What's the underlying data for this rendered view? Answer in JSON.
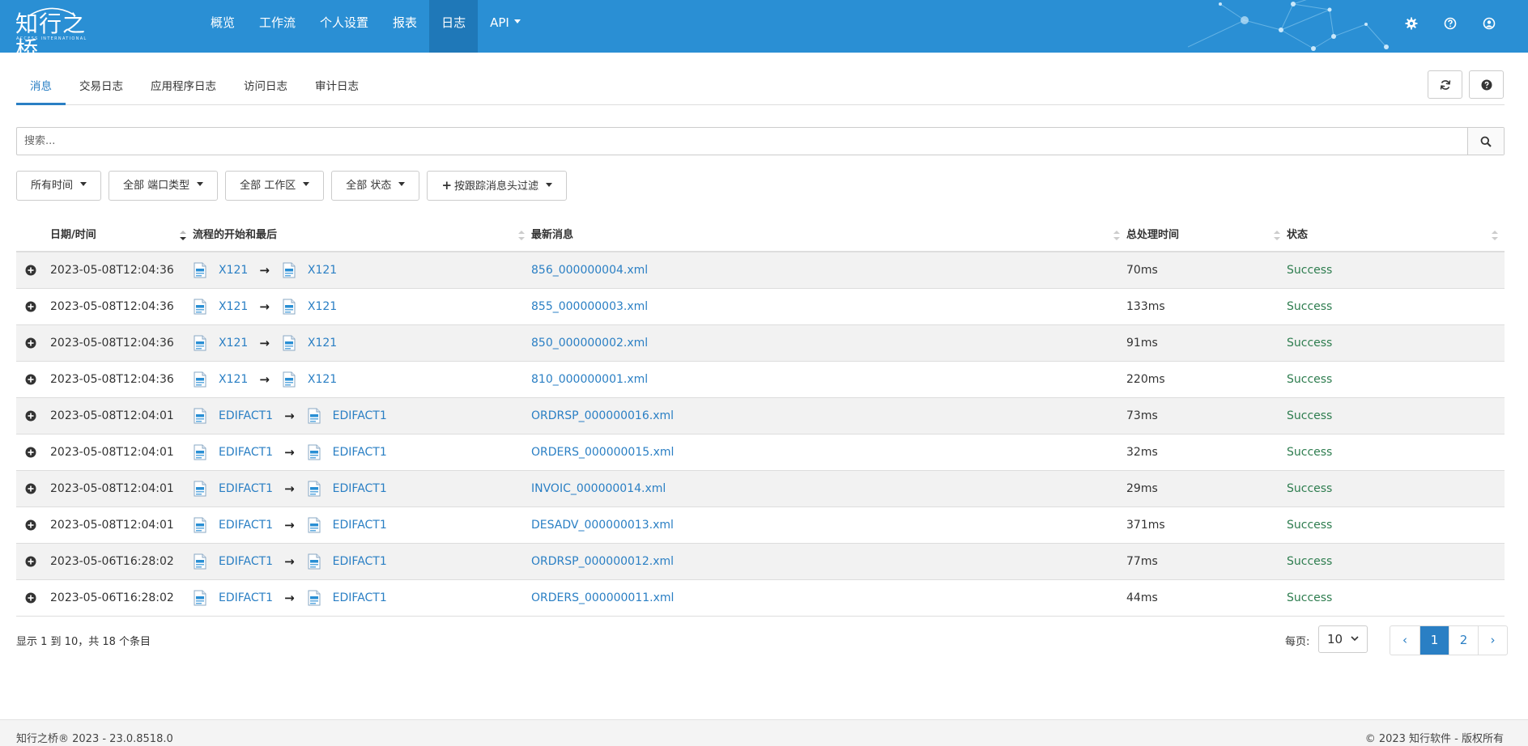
{
  "brand": {
    "logo_text": "知行之桥",
    "logo_subtext": "ACCESS INTERNATIONAL",
    "color": "#2a8fd4"
  },
  "nav": {
    "items": [
      {
        "label": "概览"
      },
      {
        "label": "工作流"
      },
      {
        "label": "个人设置"
      },
      {
        "label": "报表"
      },
      {
        "label": "日志",
        "active": true
      },
      {
        "label": "API",
        "dropdown": true
      }
    ],
    "icons": [
      "gear-icon",
      "help-circle-icon",
      "user-circle-icon"
    ]
  },
  "tabs": [
    {
      "label": "消息",
      "active": true
    },
    {
      "label": "交易日志"
    },
    {
      "label": "应用程序日志"
    },
    {
      "label": "访问日志"
    },
    {
      "label": "审计日志"
    }
  ],
  "toolbar": {
    "icons": [
      "refresh-icon",
      "question-icon"
    ]
  },
  "search": {
    "placeholder": "搜索...",
    "value": ""
  },
  "filters": {
    "time": "所有时间",
    "port_type": "全部 端口类型",
    "workspace": "全部 工作区",
    "status": "全部 状态",
    "header_filter": "按跟踪消息头过滤"
  },
  "table": {
    "columns": [
      "日期/时间",
      "流程的开始和最后",
      "最新消息",
      "总处理时间",
      "状态"
    ],
    "rows": [
      {
        "datetime": "2023-05-08T12:04:36",
        "from": "X121",
        "to": "X121",
        "message": "856_000000004.xml",
        "time": "70ms",
        "status": "Success"
      },
      {
        "datetime": "2023-05-08T12:04:36",
        "from": "X121",
        "to": "X121",
        "message": "855_000000003.xml",
        "time": "133ms",
        "status": "Success"
      },
      {
        "datetime": "2023-05-08T12:04:36",
        "from": "X121",
        "to": "X121",
        "message": "850_000000002.xml",
        "time": "91ms",
        "status": "Success"
      },
      {
        "datetime": "2023-05-08T12:04:36",
        "from": "X121",
        "to": "X121",
        "message": "810_000000001.xml",
        "time": "220ms",
        "status": "Success"
      },
      {
        "datetime": "2023-05-08T12:04:01",
        "from": "EDIFACT1",
        "to": "EDIFACT1",
        "message": "ORDRSP_000000016.xml",
        "time": "73ms",
        "status": "Success"
      },
      {
        "datetime": "2023-05-08T12:04:01",
        "from": "EDIFACT1",
        "to": "EDIFACT1",
        "message": "ORDERS_000000015.xml",
        "time": "32ms",
        "status": "Success"
      },
      {
        "datetime": "2023-05-08T12:04:01",
        "from": "EDIFACT1",
        "to": "EDIFACT1",
        "message": "INVOIC_000000014.xml",
        "time": "29ms",
        "status": "Success"
      },
      {
        "datetime": "2023-05-08T12:04:01",
        "from": "EDIFACT1",
        "to": "EDIFACT1",
        "message": "DESADV_000000013.xml",
        "time": "371ms",
        "status": "Success"
      },
      {
        "datetime": "2023-05-06T16:28:02",
        "from": "EDIFACT1",
        "to": "EDIFACT1",
        "message": "ORDRSP_000000012.xml",
        "time": "77ms",
        "status": "Success"
      },
      {
        "datetime": "2023-05-06T16:28:02",
        "from": "EDIFACT1",
        "to": "EDIFACT1",
        "message": "ORDERS_000000011.xml",
        "time": "44ms",
        "status": "Success"
      }
    ],
    "arrow": "→"
  },
  "pagination": {
    "info": "显示 1 到 10，共 18 个条目",
    "per_page_label": "每页:",
    "per_page_value": "10",
    "prev": "‹",
    "pages": [
      "1",
      "2"
    ],
    "current": "1",
    "next": "›"
  },
  "footer": {
    "left": "知行之桥® 2023 - 23.0.8518.0",
    "right": "© 2023 知行软件 - 版权所有"
  },
  "colors": {
    "link": "#2a7fc4",
    "success": "#2e7d4f",
    "navbar": "#2a8fd4",
    "navbar_active": "#1f78b8"
  }
}
